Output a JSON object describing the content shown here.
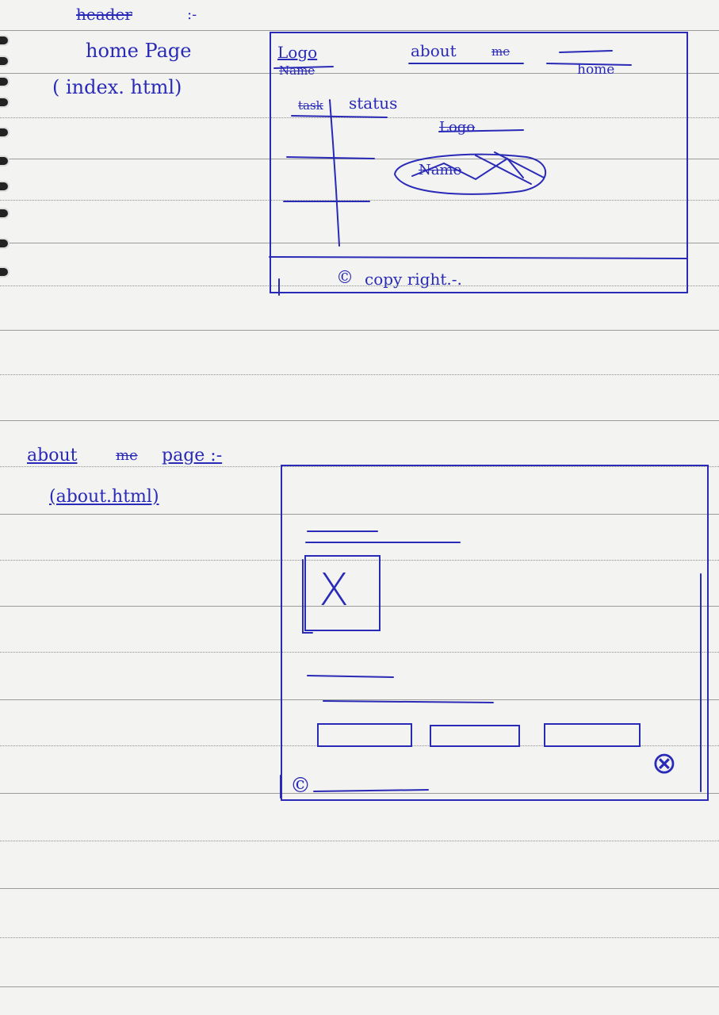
{
  "notes": {
    "heading_crossed": "header",
    "heading_suffix": ":-",
    "home_page_label": "home Page",
    "home_page_file": "( index. html)",
    "about_page_label": "about",
    "about_page_crossed": "me",
    "about_page_suffix": "page :-",
    "about_page_file": "(about.html)"
  },
  "home_sketch": {
    "logo": "Logo",
    "name": "Name",
    "nav_about": "about",
    "nav_about_crossed": "me",
    "nav_home": "home",
    "col_task": "task",
    "col_status": "status",
    "scribble_1": "Logo",
    "scribble_2": "Name",
    "copyright_symbol": "©",
    "copyright_text": "copy right.-."
  },
  "about_sketch": {
    "image_placeholder": "X",
    "copyright_symbol": "©",
    "close_symbol": "⊗"
  },
  "colors": {
    "ink": "#2a2ab8",
    "paper": "#f3f3f1",
    "rule": "#9a9a98"
  }
}
